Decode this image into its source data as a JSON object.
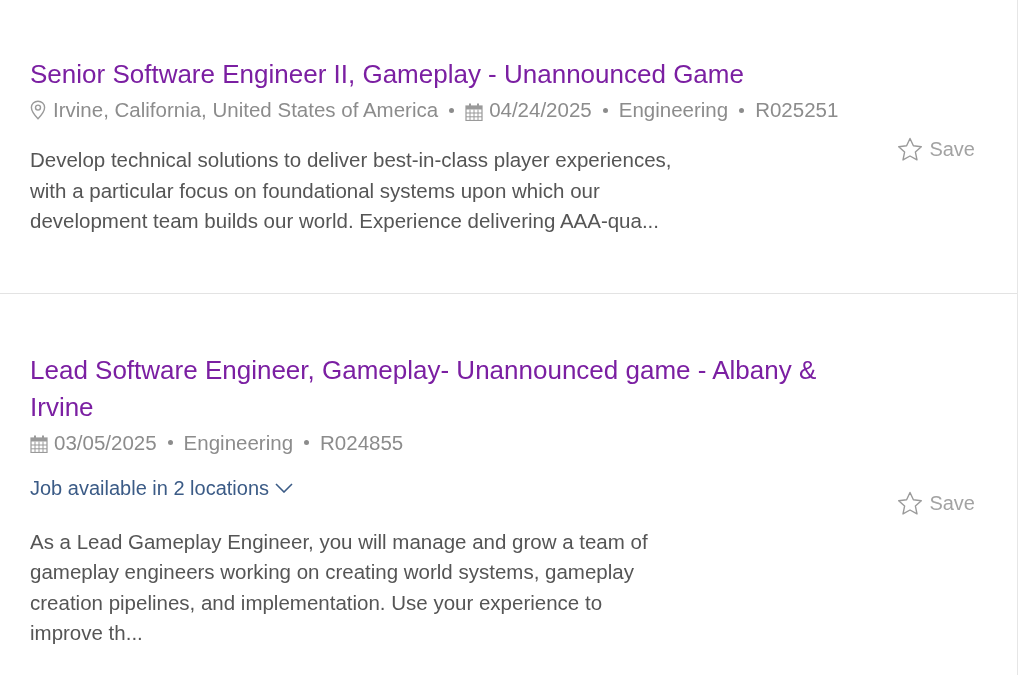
{
  "jobs": [
    {
      "title": "Senior Software Engineer II, Gameplay - Unannounced Game",
      "location": "Irvine, California, United States of America",
      "date": "04/24/2025",
      "category": "Engineering",
      "req_id": "R025251",
      "description": "Develop technical solutions to deliver best-in-class player experiences, with a particular focus on foundational systems upon which our development team builds our world. Experience delivering AAA-qua...",
      "save": "Save",
      "saved": false
    },
    {
      "title": "Lead Software Engineer, Gameplay- Unannounced game - Albany & Irvine",
      "date": "03/05/2025",
      "category": "Engineering",
      "req_id": "R024855",
      "locations_toggle": {
        "label": "Job available in 2 locations",
        "expanded": false
      },
      "description": "As a Lead Gameplay Engineer, you will manage and grow a team of gameplay engineers working on creating world systems, gameplay creation pipelines, and implementation. Use your experience to improve th...",
      "save": "Save",
      "saved": false
    }
  ]
}
